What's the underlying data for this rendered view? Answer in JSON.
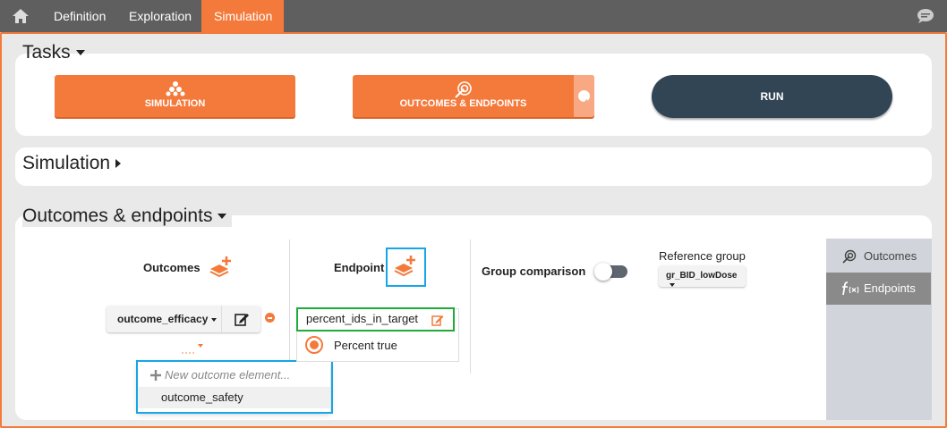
{
  "nav": {
    "tabs": [
      {
        "label": "Definition"
      },
      {
        "label": "Exploration"
      },
      {
        "label": "Simulation",
        "active": true
      }
    ],
    "home_icon": "home-icon",
    "chat_icon": "chat-bubble-icon"
  },
  "tasks": {
    "title": "Tasks",
    "simulation_label": "SIMULATION",
    "outcomes_label": "OUTCOMES & ENDPOINTS",
    "run_label": "RUN"
  },
  "simulation_section": {
    "title": "Simulation"
  },
  "outcomes_section": {
    "title": "Outcomes & endpoints",
    "outcomes_header": "Outcomes",
    "endpoint_header": "Endpoint",
    "outcome_select": "outcome_efficacy",
    "endpoint_name": "percent_ids_in_target",
    "endpoint_option": "Percent true",
    "group_comparison_label": "Group comparison",
    "group_comparison_on": false,
    "reference_group_label": "Reference group",
    "reference_group_value": "gr_BID_lowDose",
    "dropdown": {
      "new_item": "New outcome element...",
      "options": [
        "outcome_safety"
      ]
    },
    "side_menu": [
      {
        "label": "Outcomes",
        "active": false
      },
      {
        "label": "Endpoints",
        "active": true
      }
    ]
  },
  "colors": {
    "accent": "#f47a3b",
    "dark_button": "#324555",
    "topbar": "#5f5f5f",
    "highlight_green": "#1faa3a",
    "highlight_blue": "#15a6e6"
  }
}
